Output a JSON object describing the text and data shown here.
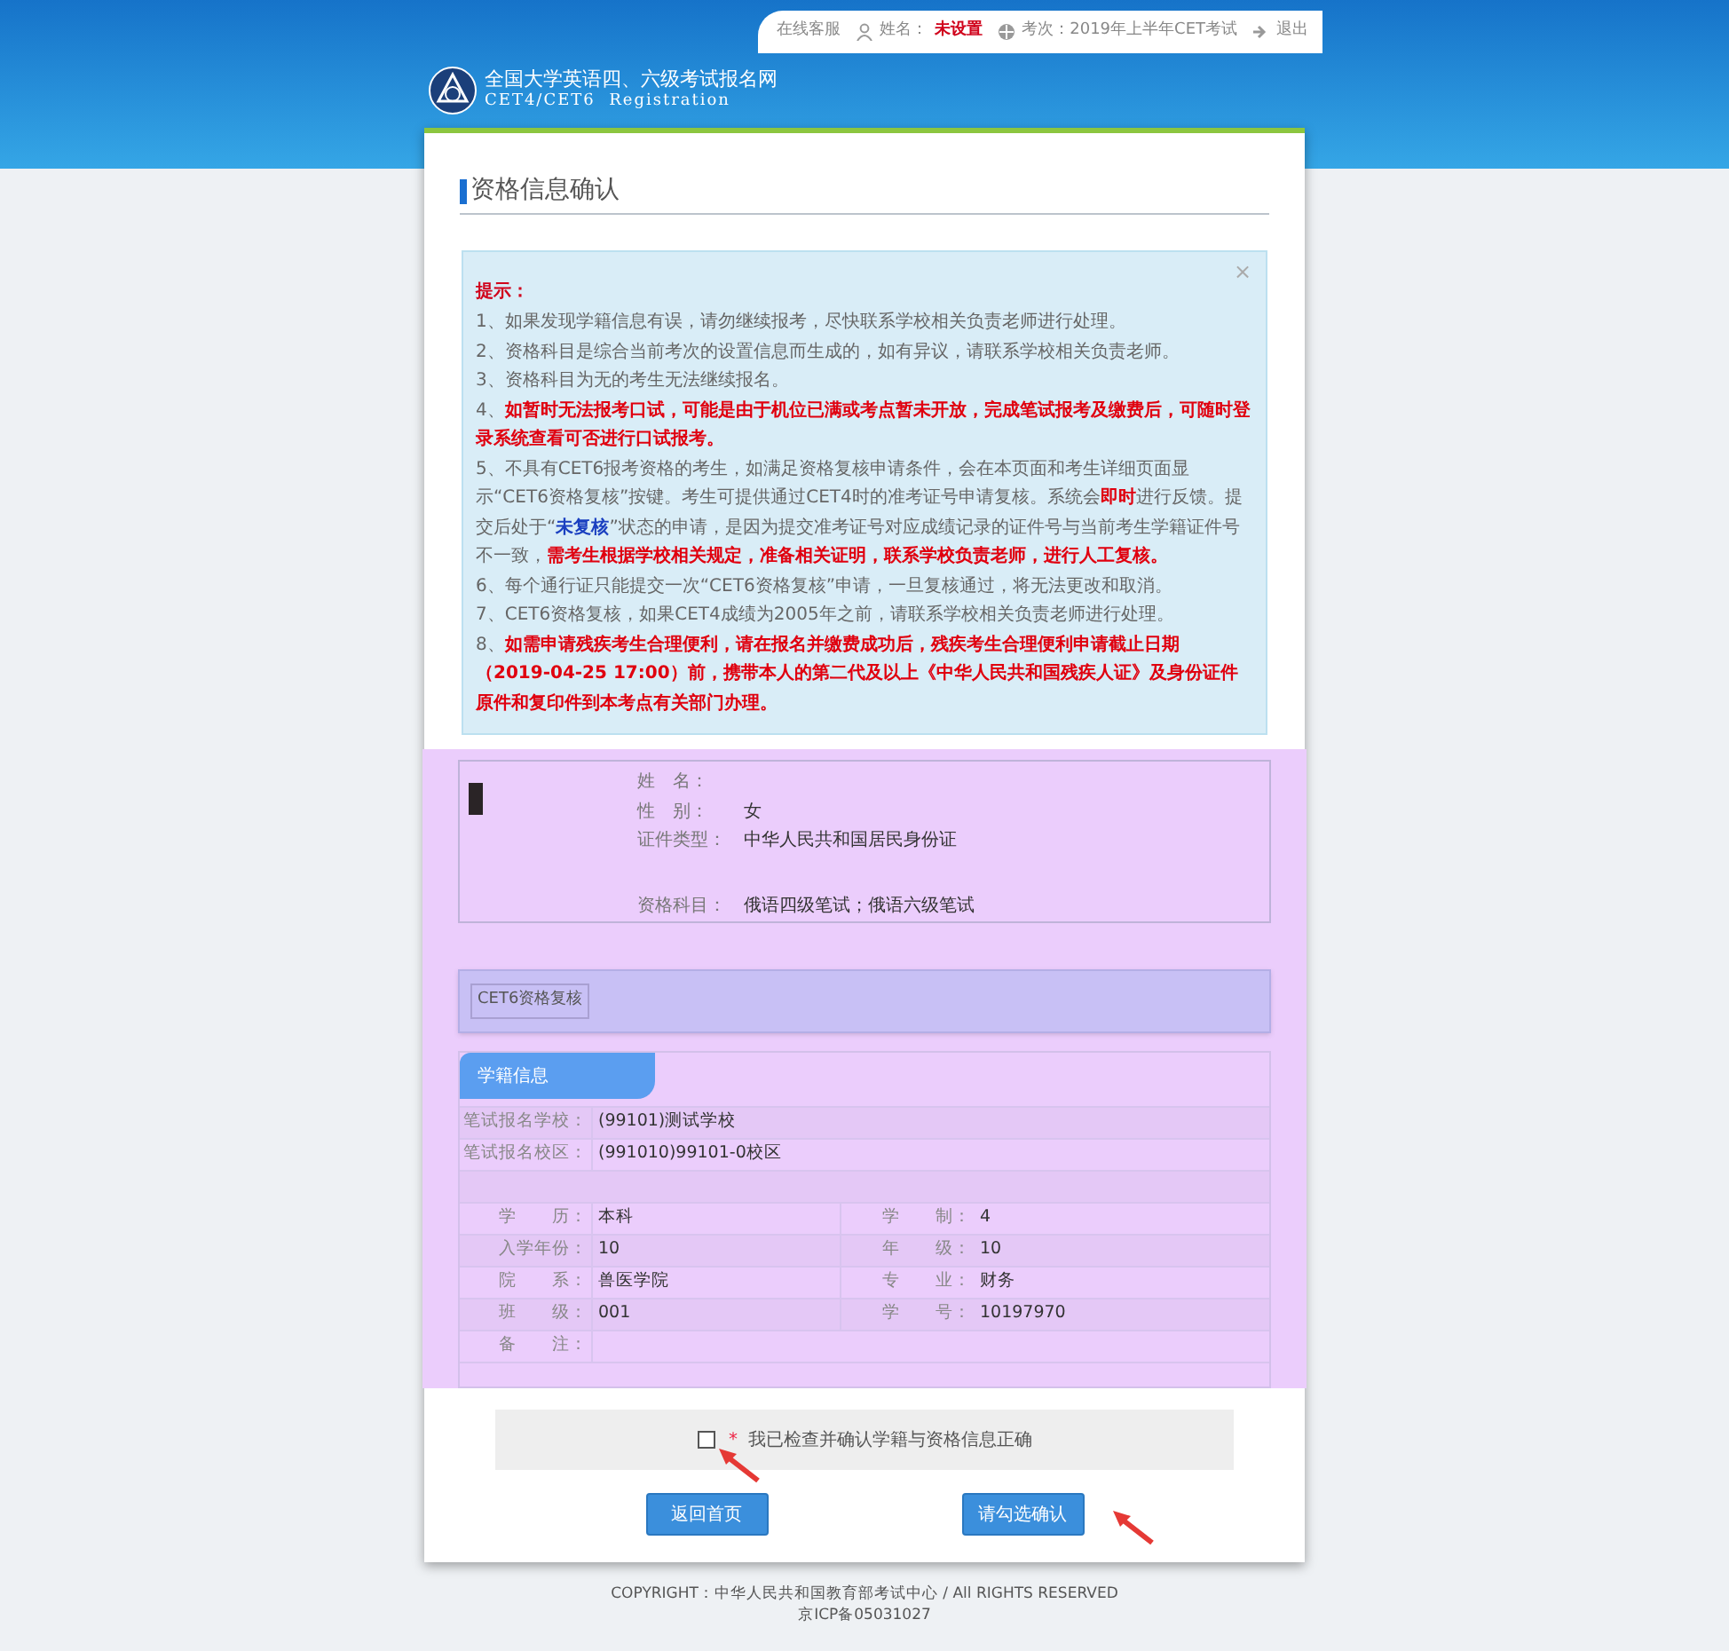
{
  "top_bar": {
    "service_link": "在线客服",
    "name_label": "姓名：",
    "name_value": "未设置",
    "session_label": "考次：2019年上半年CET考试",
    "logout": "退出"
  },
  "logo": {
    "title": "全国大学英语四、六级考试报名网",
    "subtitle": "CET4/CET6  Registration"
  },
  "page_title": "资格信息确认",
  "notice": {
    "heading": "提示：",
    "close": "×",
    "items": [
      {
        "segments": [
          {
            "kind": "normal",
            "text": "1、如果发现学籍信息有误，请勿继续报考，尽快联系学校相关负责老师进行处理。"
          }
        ]
      },
      {
        "segments": [
          {
            "kind": "normal",
            "text": "2、资格科目是综合当前考次的设置信息而生成的，如有异议，请联系学校相关负责老师。"
          }
        ]
      },
      {
        "segments": [
          {
            "kind": "normal",
            "text": "3、资格科目为无的考生无法继续报名。"
          }
        ]
      },
      {
        "segments": [
          {
            "kind": "normal",
            "text": "4、"
          },
          {
            "kind": "red",
            "text": "如暂时无法报考口试，可能是由于机位已满或考点暂未开放，完成笔试报考及缴费后，可随时登录系统查看可否进行口试报考。"
          }
        ]
      },
      {
        "segments": [
          {
            "kind": "normal",
            "text": "5、不具有CET6报考资格的考生，如满足资格复核申请条件，会在本页面和考生详细页面显示“CET6资格复核”按键。考生可提供通过CET4时的准考证号申请复核。系统会"
          },
          {
            "kind": "red",
            "text": "即时"
          },
          {
            "kind": "normal",
            "text": "进行反馈。提交后处于“"
          },
          {
            "kind": "blue",
            "text": "未复核"
          },
          {
            "kind": "normal",
            "text": "”状态的申请，是因为提交准考证号对应成绩记录的证件号与当前考生学籍证件号不一致，"
          },
          {
            "kind": "red",
            "text": "需考生根据学校相关规定，准备相关证明，联系学校负责老师，进行人工复核。"
          }
        ]
      },
      {
        "segments": [
          {
            "kind": "normal",
            "text": "6、每个通行证只能提交一次“CET6资格复核”申请，一旦复核通过，将无法更改和取消。"
          }
        ]
      },
      {
        "segments": [
          {
            "kind": "normal",
            "text": "7、CET6资格复核，如果CET4成绩为2005年之前，请联系学校相关负责老师进行处理。"
          }
        ]
      },
      {
        "segments": [
          {
            "kind": "normal",
            "text": "8、"
          },
          {
            "kind": "red",
            "text": "如需申请残疾考生合理便利，请在报名并缴费成功后，残疾考生合理便利申请截止日期（2019-04-25 17:00）前，携带本人的第二代及以上《中华人民共和国残疾人证》及身份证件原件和复印件到本考点有关部门办理。"
          }
        ]
      }
    ]
  },
  "personal_info": [
    {
      "label": "姓　名："
    },
    {
      "label": "性　别：",
      "value": "女"
    },
    {
      "label": "证件类型：",
      "value": "中华人民共和国居民身份证"
    },
    {
      "label": "资格科目：",
      "value": "俄语四级笔试；俄语六级笔试"
    }
  ],
  "review_button": "CET6资格复核",
  "student_info": {
    "tab": "学籍信息",
    "wide_rows": [
      {
        "label": "笔试报名学校：",
        "value": "(99101)测试学校"
      },
      {
        "label": "笔试报名校区：",
        "value": "(991010)99101-0校区"
      }
    ],
    "pair_rows": [
      [
        {
          "label": "学　　历：",
          "value": "本科"
        },
        {
          "label": "学　　制：",
          "value": "4"
        }
      ],
      [
        {
          "label": "入学年份：",
          "value": "10"
        },
        {
          "label": "年　　级：",
          "value": "10"
        }
      ],
      [
        {
          "label": "院　　系：",
          "value": "兽医学院"
        },
        {
          "label": "专　　业：",
          "value": "财务"
        }
      ],
      [
        {
          "label": "班　　级：",
          "value": "001"
        },
        {
          "label": "学　　号：",
          "value": "10197970"
        }
      ]
    ],
    "remark_label": "备　　注："
  },
  "confirm": {
    "required_mark": "*",
    "label": "我已检查并确认学籍与资格信息正确",
    "checked": false
  },
  "buttons": [
    "返回首页",
    "请勾选确认"
  ],
  "footer": [
    "COPYRIGHT：中华人民共和国教育部考试中心 / All RIGHTS RESERVED",
    "京ICP备05031027"
  ]
}
